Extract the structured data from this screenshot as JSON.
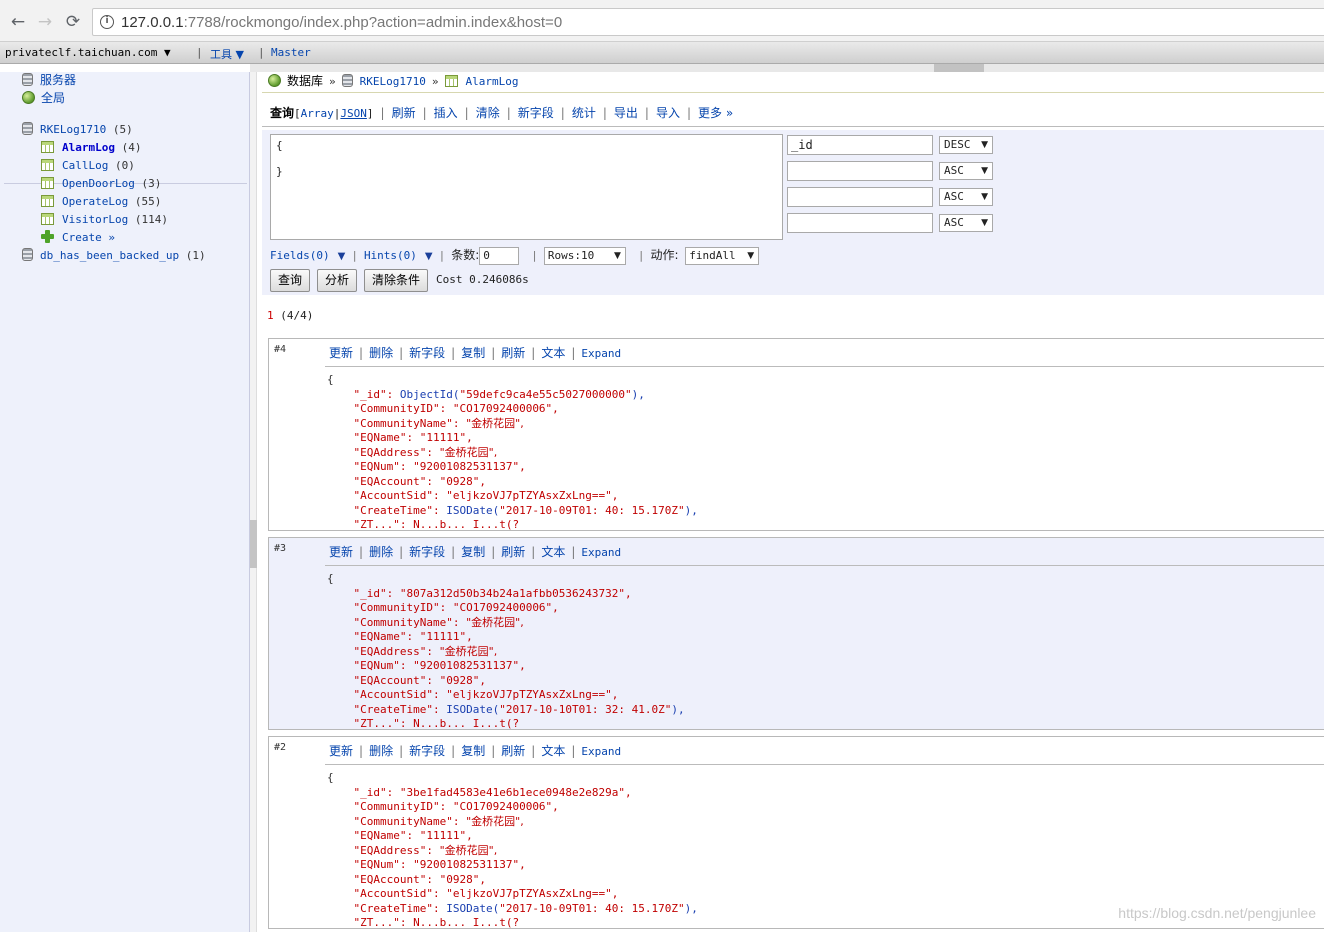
{
  "browser": {
    "url_host": "127.0.0.1",
    "url_rest": ":7788/rockmongo/index.php?action=admin.index&host=0"
  },
  "topbar": {
    "host": "privateclf.taichuan.com ▼",
    "tools": "工具 ▼",
    "master": "Master"
  },
  "sidebar": {
    "servers": "服务器",
    "global": "全局",
    "database": {
      "name": "RKELog1710",
      "count": "(5)"
    },
    "collections": [
      {
        "name": "AlarmLog",
        "count": "(4)"
      },
      {
        "name": "CallLog",
        "count": "(0)"
      },
      {
        "name": "OpenDoorLog",
        "count": "(3)"
      },
      {
        "name": "OperateLog",
        "count": "(55)"
      },
      {
        "name": "VisitorLog",
        "count": "(114)"
      }
    ],
    "create": "Create »",
    "other_db": {
      "name": "db_has_been_backed_up",
      "count": "(1)"
    }
  },
  "breadcrumb": {
    "databases": "数据库",
    "db": "RKELog1710",
    "collection": "AlarmLog",
    "arrow": "»"
  },
  "op_menu": {
    "query": "查询",
    "array": "Array",
    "json": "JSON",
    "refresh": "刷新",
    "insert": "插入",
    "clear": "清除",
    "new_field": "新字段",
    "stats": "统计",
    "export": "导出",
    "import": "导入",
    "more": "更多 »"
  },
  "query": {
    "criteria": "{\n\n}",
    "sort": [
      {
        "field": "_id",
        "dir": "DESC"
      },
      {
        "field": "",
        "dir": "ASC"
      },
      {
        "field": "",
        "dir": "ASC"
      },
      {
        "field": "",
        "dir": "ASC"
      }
    ],
    "fields": "Fields(0)",
    "hints": "Hints(0)",
    "limit_label": "条数:",
    "limit_value": "0",
    "rows": "Rows:10",
    "action_label": "动作:",
    "action_value": "findAll",
    "btn_query": "查询",
    "btn_explain": "分析",
    "btn_clear": "清除条件",
    "cost": "Cost 0.246086s"
  },
  "pager": {
    "page": "1",
    "range": "(4/4)"
  },
  "record_menu": {
    "update": "更新",
    "delete": "删除",
    "new_field": "新字段",
    "duplicate": "复制",
    "refresh": "刷新",
    "text": "文本",
    "expand": "Expand"
  },
  "records": [
    {
      "num": "#4",
      "id_func": "ObjectId(",
      "id": "\"59defc9ca4e55c5027000000\"",
      "id_close": "),",
      "community_id": "\"CO17092400006\",",
      "community_name": "\"金桥花园\",",
      "eq_name": "\"11111\",",
      "eq_address": "\"金桥花园\",",
      "eq_num": "\"92001082531137\",",
      "eq_account": "\"0928\",",
      "account_sid": "\"eljkzoVJ7pTZYAsxZxLng==\",",
      "create_time": "\"2017-10-09T01: 40: 15.170Z\"",
      "tail": "\"ZT...\": N...b... I...t(?"
    },
    {
      "num": "#3",
      "id_func": "",
      "id": "\"807a312d50b34b24a1afbb0536243732\"",
      "id_close": ",",
      "community_id": "\"CO17092400006\",",
      "community_name": "\"金桥花园\",",
      "eq_name": "\"11111\",",
      "eq_address": "\"金桥花园\",",
      "eq_num": "\"92001082531137\",",
      "eq_account": "\"0928\",",
      "account_sid": "\"eljkzoVJ7pTZYAsxZxLng==\",",
      "create_time": "\"2017-10-10T01: 32: 41.0Z\"",
      "tail": "\"ZT...\": N...b... I...t(?"
    },
    {
      "num": "#2",
      "id_func": "",
      "id": "\"3be1fad4583e41e6b1ece0948e2e829a\"",
      "id_close": ",",
      "community_id": "\"CO17092400006\",",
      "community_name": "\"金桥花园\",",
      "eq_name": "\"11111\",",
      "eq_address": "\"金桥花园\",",
      "eq_num": "\"92001082531137\",",
      "eq_account": "\"0928\",",
      "account_sid": "\"eljkzoVJ7pTZYAsxZxLng==\",",
      "create_time": "\"2017-10-09T01: 40: 15.170Z\"",
      "tail": "\"ZT...\": N...b... I...t(?"
    }
  ],
  "json_keys": {
    "open": "{",
    "id": "\"_id\": ",
    "community_id": "\"CommunityID\": ",
    "community_name": "\"CommunityName\": ",
    "eq_name": "\"EQName\": ",
    "eq_address": "\"EQAddress\": ",
    "eq_num": "\"EQNum\": ",
    "eq_account": "\"EQAccount\": ",
    "account_sid": "\"AccountSid\": ",
    "create_time": "\"CreateTime\": ",
    "iso_func": "ISODate(",
    "iso_close": "),"
  },
  "watermark": "https://blog.csdn.net/pengjunlee"
}
